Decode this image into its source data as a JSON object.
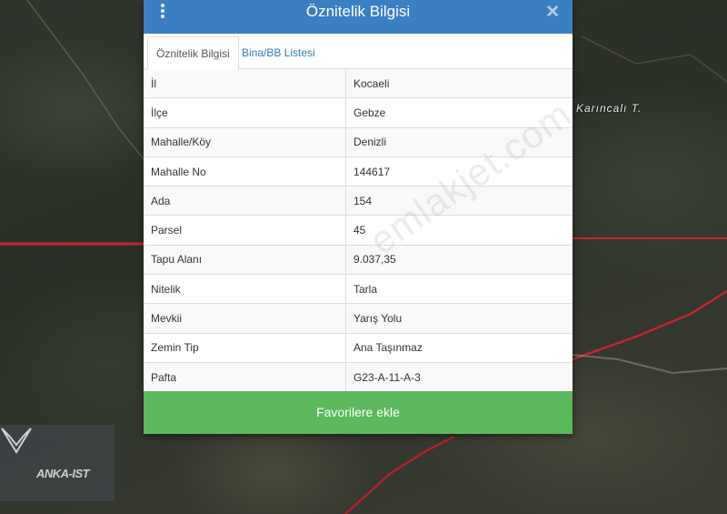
{
  "map": {
    "place_label": "Karıncalı T.",
    "logo_text": "ANKA-IST"
  },
  "dialog": {
    "title": "Öznitelik Bilgisi",
    "menu_icon": "kebab-icon",
    "close_icon": "close-icon",
    "close_glyph": "✕",
    "tabs": [
      {
        "label": "Öznitelik Bilgisi",
        "active": true
      },
      {
        "label": "Bina/BB Listesi",
        "active": false
      }
    ],
    "rows": [
      {
        "key": "İl",
        "value": "Kocaeli"
      },
      {
        "key": "İlçe",
        "value": "Gebze"
      },
      {
        "key": "Mahalle/Köy",
        "value": "Denizli"
      },
      {
        "key": "Mahalle No",
        "value": "144617"
      },
      {
        "key": "Ada",
        "value": "154"
      },
      {
        "key": "Parsel",
        "value": "45"
      },
      {
        "key": "Tapu Alanı",
        "value": "9.037,35"
      },
      {
        "key": "Nitelik",
        "value": "Tarla"
      },
      {
        "key": "Mevkii",
        "value": "Yarış Yolu"
      },
      {
        "key": "Zemin Tip",
        "value": "Ana Taşınmaz"
      },
      {
        "key": "Pafta",
        "value": "G23-A-11-A-3"
      }
    ],
    "favorite_button": "Favorilere ekle",
    "watermark": "emlakjet.com"
  },
  "colors": {
    "header": "#3c7ec2",
    "button": "#5cb85c",
    "parcel_line": "#c0282d"
  }
}
